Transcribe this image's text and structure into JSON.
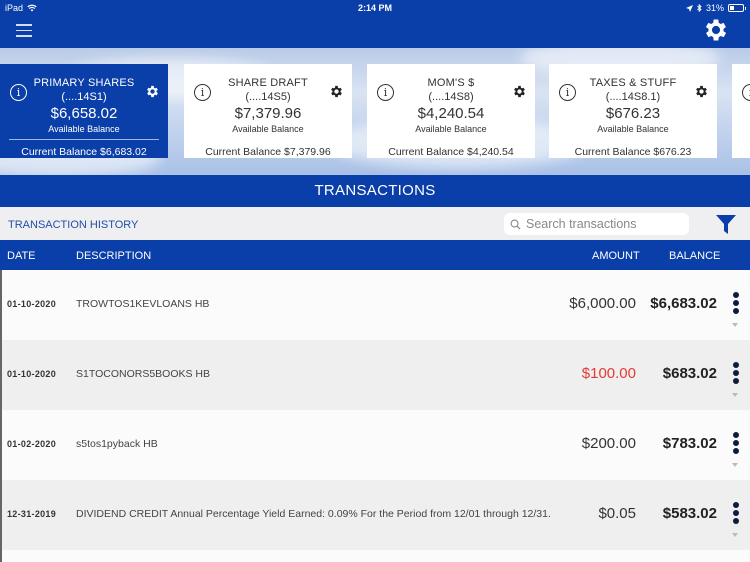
{
  "status_bar": {
    "device": "iPad",
    "time": "2:14 PM",
    "battery": "31%"
  },
  "nav": {
    "menu_icon": "hamburger-menu-icon",
    "settings_icon": "gear-icon"
  },
  "accounts": [
    {
      "name": "PRIMARY SHARES",
      "number": "(....14S1)",
      "available_balance": "$6,658.02",
      "available_label": "Available Balance",
      "current_balance": "Current Balance $6,683.02",
      "active": true
    },
    {
      "name": "SHARE DRAFT",
      "number": "(....14S5)",
      "available_balance": "$7,379.96",
      "available_label": "Available Balance",
      "current_balance": "Current Balance $7,379.96",
      "active": false
    },
    {
      "name": "MOM'S $",
      "number": "(....14S8)",
      "available_balance": "$4,240.54",
      "available_label": "Available Balance",
      "current_balance": "Current Balance $4,240.54",
      "active": false
    },
    {
      "name": "TAXES & STUFF",
      "number": "(....14S8.1)",
      "available_balance": "$676.23",
      "available_label": "Available Balance",
      "current_balance": "Current Balance $676.23",
      "active": false
    }
  ],
  "transactions_section": {
    "title": "TRANSACTIONS",
    "history_label": "TRANSACTION HISTORY",
    "search_placeholder": "Search transactions",
    "search_value": "",
    "columns": {
      "date": "DATE",
      "description": "DESCRIPTION",
      "amount": "AMOUNT",
      "balance": "BALANCE"
    },
    "rows": [
      {
        "date": "01-10-2020",
        "description": "TROWTOS1KEVLOANS HB",
        "amount": "$6,000.00",
        "type": "credit",
        "balance": "$6,683.02"
      },
      {
        "date": "01-10-2020",
        "description": "S1TOCONORS5BOOKS HB",
        "amount": "$100.00",
        "type": "debit",
        "balance": "$683.02"
      },
      {
        "date": "01-02-2020",
        "description": "s5tos1pyback HB",
        "amount": "$200.00",
        "type": "credit",
        "balance": "$783.02"
      },
      {
        "date": "12-31-2019",
        "description": "DIVIDEND CREDIT Annual Percentage Yield Earned: 0.09% For the Period from 12/01 through 12/31.",
        "amount": "$0.05",
        "type": "credit",
        "balance": "$583.02"
      }
    ]
  },
  "colors": {
    "brand_blue": "#0a3ea8",
    "debit_red": "#e53935",
    "link_blue": "#1f4fa8"
  }
}
